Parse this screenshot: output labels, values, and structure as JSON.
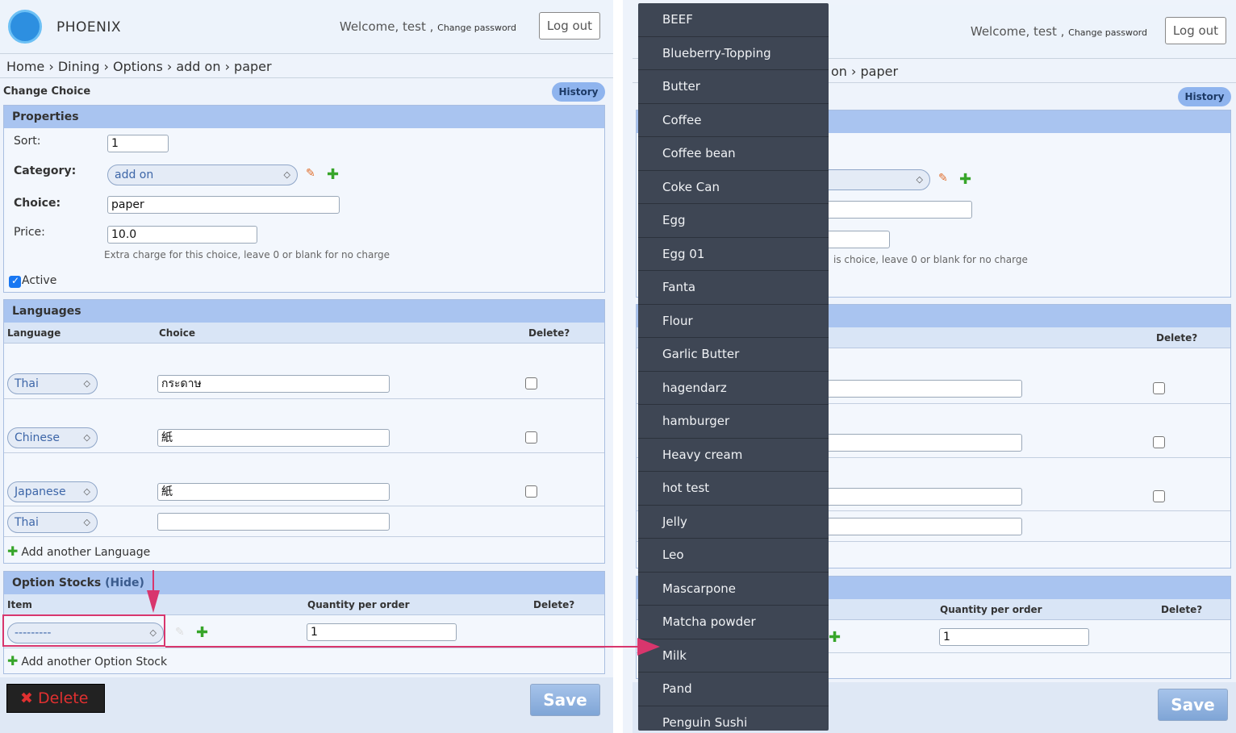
{
  "app": {
    "name": "PHOENIX"
  },
  "header": {
    "welcome": "Welcome, test",
    "change_password": "Change password",
    "logout_label": "Log out"
  },
  "breadcrumb": [
    "Home",
    "Dining",
    "Options",
    "add on",
    "paper"
  ],
  "breadcrumb_text": "Home › Dining › Options › add on › paper",
  "breadcrumb_partial": "on › paper",
  "page": {
    "title": "Change Choice",
    "history_label": "History"
  },
  "properties": {
    "heading": "Properties",
    "sort_label": "Sort:",
    "sort_value": "1",
    "category_label": "Category:",
    "category_value": "add on",
    "choice_label": "Choice:",
    "choice_value": "paper",
    "price_label": "Price:",
    "price_value": "10.0",
    "price_help": "Extra charge for this choice, leave 0 or blank for no charge",
    "price_help_partial": "is choice, leave 0 or blank for no charge",
    "active_label": "Active",
    "active_checked": true
  },
  "languages": {
    "heading": "Languages",
    "columns": [
      "Language",
      "Choice",
      "Delete?"
    ],
    "rows": [
      {
        "language": "Thai",
        "choice": "กระดาษ"
      },
      {
        "language": "Chinese",
        "choice": "紙"
      },
      {
        "language": "Japanese",
        "choice": "紙"
      },
      {
        "language": "Thai",
        "choice": ""
      }
    ],
    "add_label": "Add another Language"
  },
  "option_stocks": {
    "heading": "Option Stocks",
    "hide_label": "(Hide)",
    "columns": [
      "Item",
      "Quantity per order",
      "Delete?"
    ],
    "row": {
      "item": "---------",
      "quantity": "1"
    },
    "add_label": "Add another Option Stock"
  },
  "actions": {
    "delete_label": "Delete",
    "save_label": "Save"
  },
  "dropdown_items": [
    "BEEF",
    "Blueberry-Topping",
    "Butter",
    "Coffee",
    "Coffee bean",
    "Coke Can",
    "Egg",
    "Egg 01",
    "Fanta",
    "Flour",
    "Garlic Butter",
    "hagendarz",
    "hamburger",
    "Heavy cream",
    "hot test",
    "Jelly",
    "Leo",
    "Mascarpone",
    "Matcha powder",
    "Milk",
    "Pand",
    "Penguin Sushi"
  ],
  "colors": {
    "accent": "#a9c4f0",
    "callout": "#d8366d",
    "dropdown_bg": "#3e4654"
  }
}
